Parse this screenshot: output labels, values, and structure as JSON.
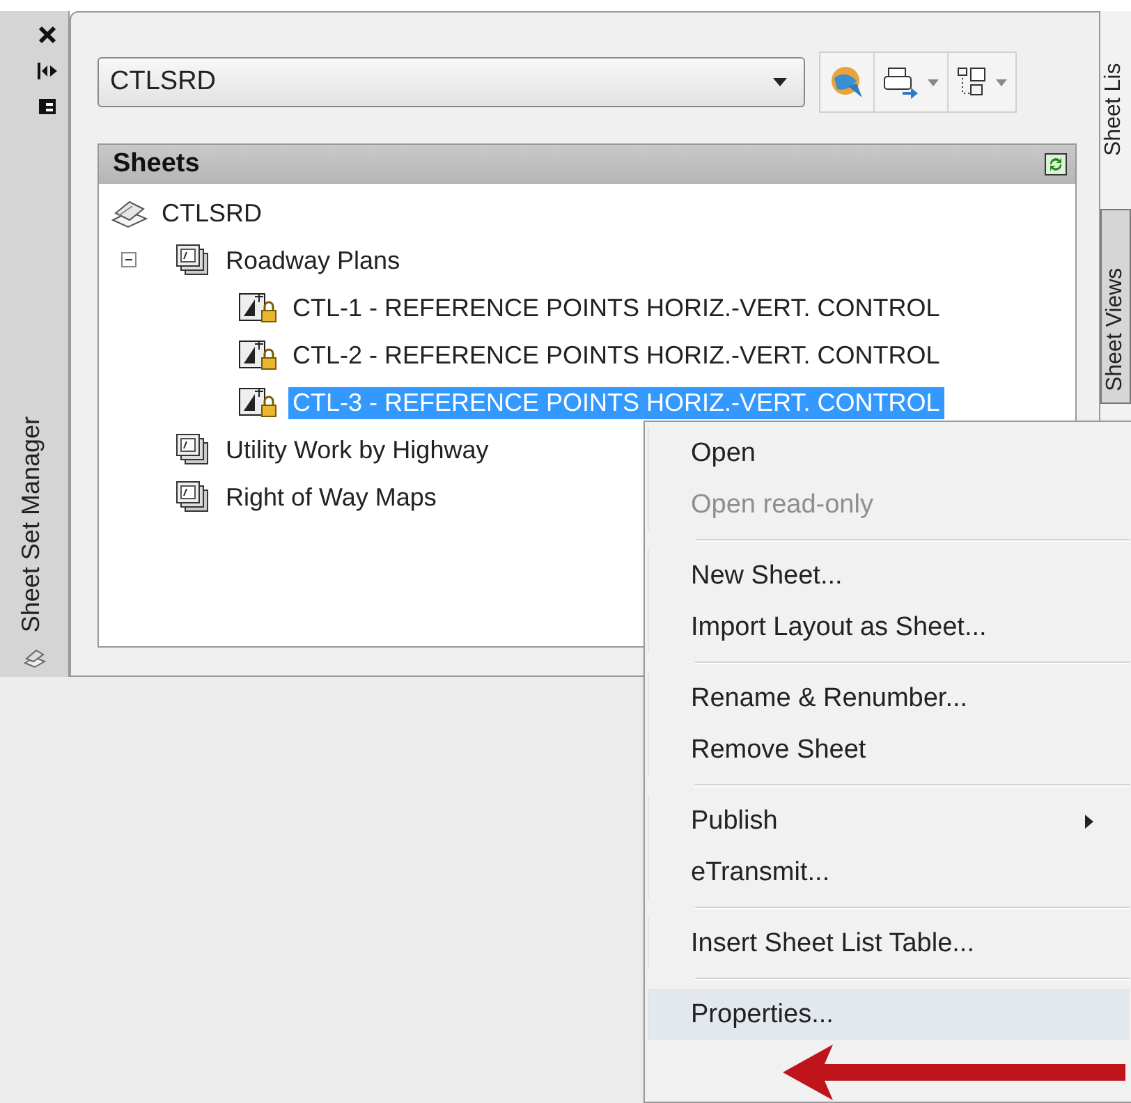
{
  "side_strip": {
    "title": "Sheet Set Manager"
  },
  "sheet_set_selector": {
    "value": "CTLSRD"
  },
  "sheets_panel": {
    "title": "Sheets",
    "tree": [
      {
        "label": "CTLSRD",
        "kind": "set",
        "selected": false,
        "children": [
          {
            "label": "Roadway Plans",
            "kind": "subset",
            "expanded": true,
            "selected": false,
            "children": [
              {
                "label": "CTL-1 - REFERENCE POINTS HORIZ.-VERT. CONTROL",
                "kind": "sheet",
                "selected": false
              },
              {
                "label": "CTL-2 - REFERENCE POINTS HORIZ.-VERT. CONTROL",
                "kind": "sheet",
                "selected": false
              },
              {
                "label": "CTL-3 - REFERENCE POINTS HORIZ.-VERT. CONTROL",
                "kind": "sheet",
                "selected": true
              }
            ]
          },
          {
            "label": "Utility Work by Highway",
            "kind": "subset",
            "selected": false
          },
          {
            "label": "Right of Way Maps",
            "kind": "subset",
            "selected": false
          }
        ]
      }
    ]
  },
  "right_tabs": [
    {
      "label": "Sheet Lis",
      "selected": true
    },
    {
      "label": "Sheet Views",
      "selected": false
    }
  ],
  "context_menu": [
    {
      "label": "Open",
      "disabled": false,
      "submenu": false,
      "selected": false
    },
    {
      "label": "Open read-only",
      "disabled": true,
      "submenu": false,
      "selected": false
    },
    {
      "kind": "separator"
    },
    {
      "label": "New Sheet...",
      "disabled": false,
      "submenu": false,
      "selected": false
    },
    {
      "label": "Import Layout as Sheet...",
      "disabled": false,
      "submenu": false,
      "selected": false
    },
    {
      "kind": "separator"
    },
    {
      "label": "Rename & Renumber...",
      "disabled": false,
      "submenu": false,
      "selected": false
    },
    {
      "label": "Remove Sheet",
      "disabled": false,
      "submenu": false,
      "selected": false
    },
    {
      "kind": "separator"
    },
    {
      "label": "Publish",
      "disabled": false,
      "submenu": true,
      "selected": false
    },
    {
      "label": "eTransmit...",
      "disabled": false,
      "submenu": false,
      "selected": false
    },
    {
      "kind": "separator"
    },
    {
      "label": "Insert Sheet List Table...",
      "disabled": false,
      "submenu": false,
      "selected": false
    },
    {
      "kind": "separator"
    },
    {
      "label": "Properties...",
      "disabled": false,
      "submenu": false,
      "selected": true
    }
  ]
}
